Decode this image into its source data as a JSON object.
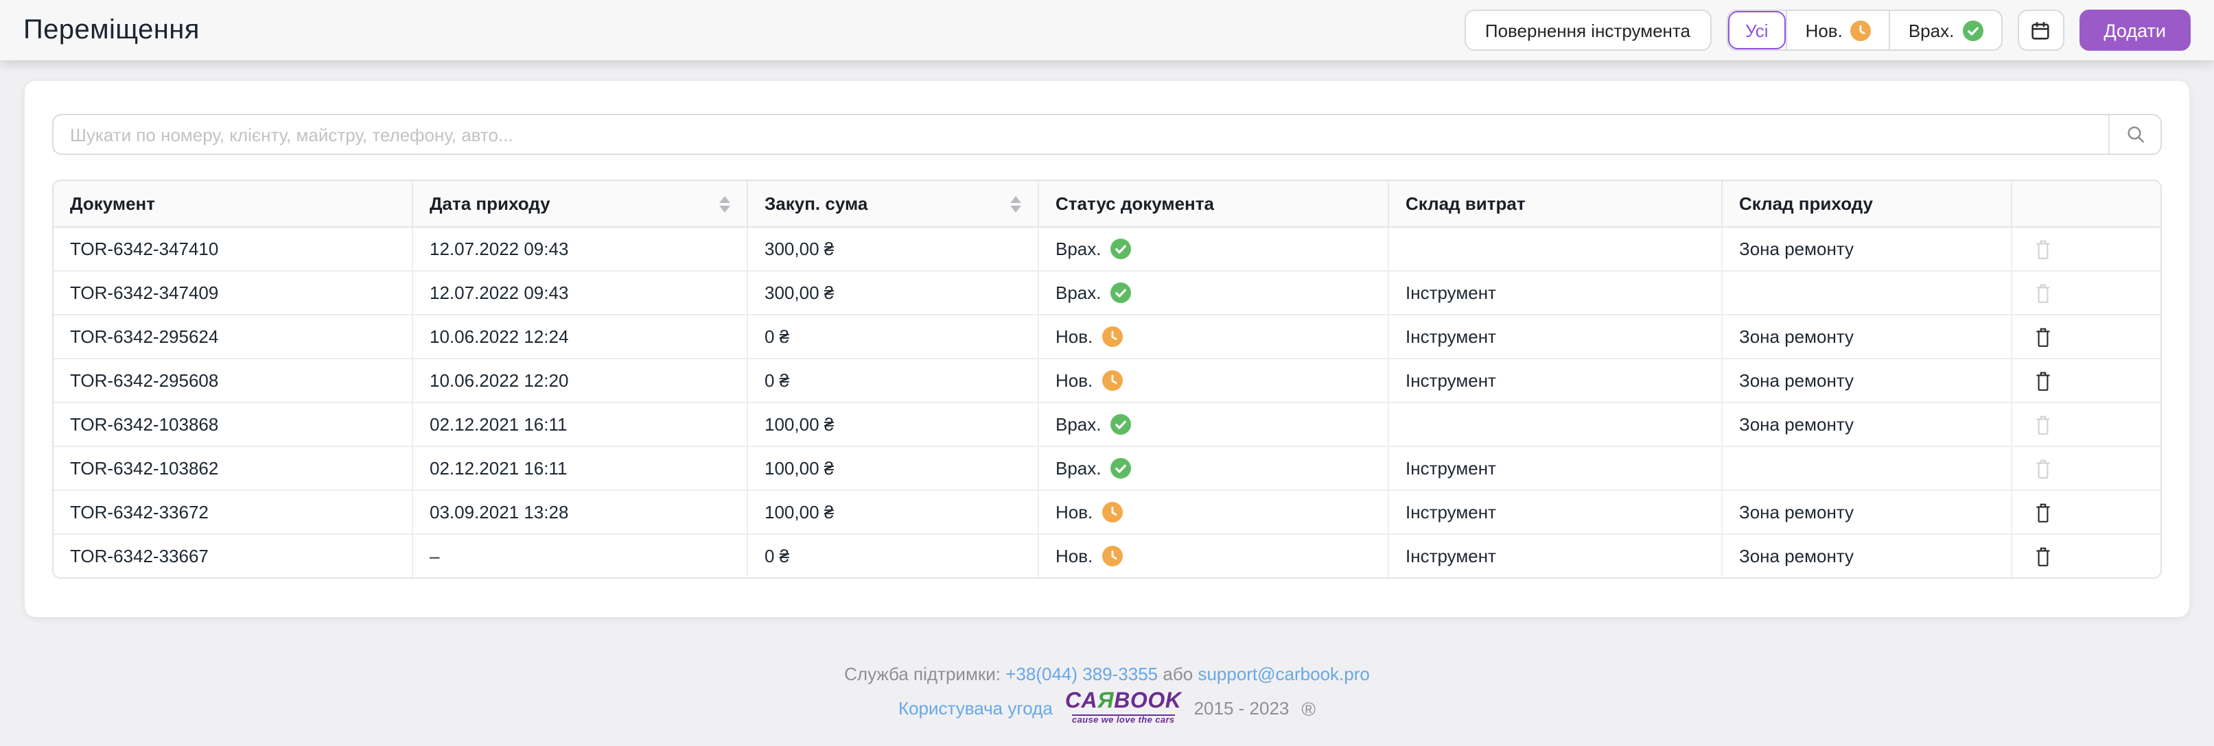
{
  "header": {
    "title": "Переміщення",
    "return_tool_button": "Повернення інструмента",
    "filters": {
      "all": "Усі",
      "new": "Нов.",
      "accounted": "Врах."
    },
    "add_button": "Додати"
  },
  "search": {
    "placeholder": "Шукати по номеру, клієнту, майстру, телефону, авто..."
  },
  "table": {
    "columns": [
      "Документ",
      "Дата приходу",
      "Закуп. сума",
      "Статус документа",
      "Склад витрат",
      "Склад приходу",
      ""
    ],
    "rows": [
      {
        "doc": "TOR-6342-347410",
        "date": "12.07.2022 09:43",
        "sum": "300,00 ₴",
        "status": "Врах.",
        "status_icon": "check",
        "expense": "",
        "income": "Зона ремонту",
        "deletable": false
      },
      {
        "doc": "TOR-6342-347409",
        "date": "12.07.2022 09:43",
        "sum": "300,00 ₴",
        "status": "Врах.",
        "status_icon": "check",
        "expense": "Інструмент",
        "income": "",
        "deletable": false
      },
      {
        "doc": "TOR-6342-295624",
        "date": "10.06.2022 12:24",
        "sum": "0 ₴",
        "status": "Нов.",
        "status_icon": "clock",
        "expense": "Інструмент",
        "income": "Зона ремонту",
        "deletable": true
      },
      {
        "doc": "TOR-6342-295608",
        "date": "10.06.2022 12:20",
        "sum": "0 ₴",
        "status": "Нов.",
        "status_icon": "clock",
        "expense": "Інструмент",
        "income": "Зона ремонту",
        "deletable": true
      },
      {
        "doc": "TOR-6342-103868",
        "date": "02.12.2021 16:11",
        "sum": "100,00 ₴",
        "status": "Врах.",
        "status_icon": "check",
        "expense": "",
        "income": "Зона ремонту",
        "deletable": false
      },
      {
        "doc": "TOR-6342-103862",
        "date": "02.12.2021 16:11",
        "sum": "100,00 ₴",
        "status": "Врах.",
        "status_icon": "check",
        "expense": "Інструмент",
        "income": "",
        "deletable": false
      },
      {
        "doc": "TOR-6342-33672",
        "date": "03.09.2021 13:28",
        "sum": "100,00 ₴",
        "status": "Нов.",
        "status_icon": "clock",
        "expense": "Інструмент",
        "income": "Зона ремонту",
        "deletable": true
      },
      {
        "doc": "TOR-6342-33667",
        "date": "–",
        "sum": "0 ₴",
        "status": "Нов.",
        "status_icon": "clock",
        "expense": "Інструмент",
        "income": "Зона ремонту",
        "deletable": true
      }
    ]
  },
  "footer": {
    "support_label": "Служба підтримки:",
    "phone": "+38(044) 389-3355",
    "or_text": "або",
    "email": "support@carbook.pro",
    "agreement_link": "Користувача угода",
    "logo_part1": "CA",
    "logo_part2": "Я",
    "logo_part3": "BOOK",
    "logo_tagline": "cause we love the cars",
    "copyright": "2015 - 2023",
    "registered_mark": "®"
  },
  "icons": {
    "search": "magnifier",
    "calendar": "calendar",
    "delete": "trash-can",
    "sort": "up-down-arrows",
    "status_new": "clock",
    "status_accounted": "check"
  },
  "colors": {
    "accent_purple": "#9a5bc8",
    "filter_selected_purple": "#9254de",
    "status_green": "#5fbb63",
    "status_orange": "#f2a94b",
    "link_blue": "#67a7e9",
    "logo_green": "#43a047",
    "logo_purple": "#6a2d91"
  }
}
